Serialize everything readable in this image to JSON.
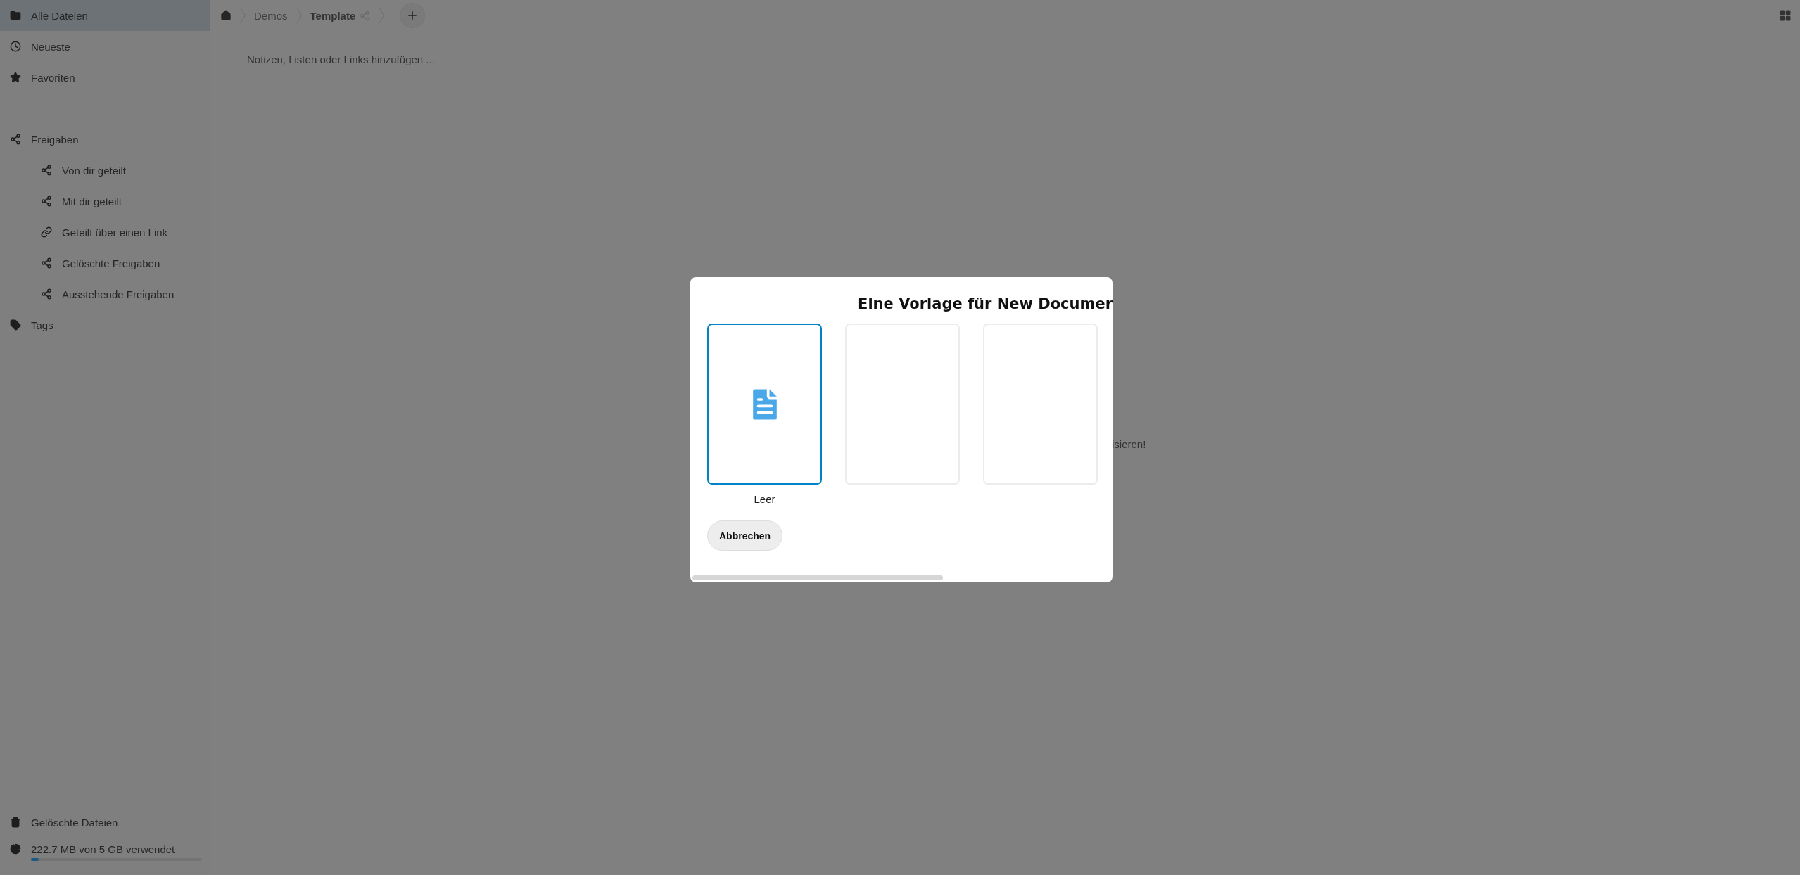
{
  "sidebar": {
    "items": [
      {
        "label": "Alle Dateien",
        "selected": true
      },
      {
        "label": "Neueste",
        "selected": false
      },
      {
        "label": "Favoriten",
        "selected": false
      },
      {
        "label": "Freigaben",
        "selected": false,
        "children": [
          {
            "label": "Von dir geteilt",
            "selected": false
          },
          {
            "label": "Mit dir geteilt",
            "selected": false
          },
          {
            "label": "Geteilt über einen Link",
            "selected": false
          },
          {
            "label": "Gelöschte Freigaben",
            "selected": false
          },
          {
            "label": "Ausstehende Freigaben",
            "selected": false
          }
        ]
      },
      {
        "label": "Tags",
        "selected": false
      }
    ],
    "footer": [
      {
        "label": "Gelöschte Dateien",
        "selected": false
      }
    ],
    "storage": {
      "label": "222.7 MB von 5 GB verwendet",
      "level": 0.045
    }
  },
  "breadcrumb": [
    {
      "label": "Demos",
      "current": false
    },
    {
      "label": "Template",
      "current": true
    }
  ],
  "notes_placeholder": "Notizen, Listen oder Links hinzufügen ...",
  "background_text": "isieren!",
  "dialog": {
    "title": "Eine Vorlage für New Documer",
    "templates": [
      {
        "kind": "blank",
        "label": "Leer",
        "selected": true
      },
      {
        "kind": "preview",
        "selected": false
      },
      {
        "kind": "preview",
        "selected": false
      }
    ],
    "cancel": "Abbrechen"
  }
}
